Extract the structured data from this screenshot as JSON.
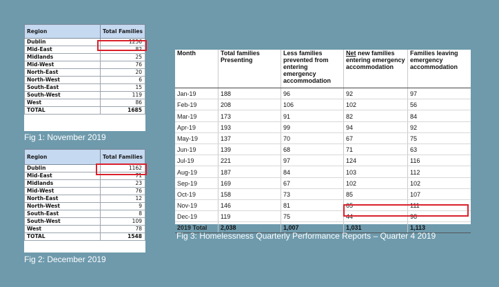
{
  "fig1": {
    "headers": [
      "Region",
      "Total Families"
    ],
    "rows": [
      [
        "Dublin",
        "1256"
      ],
      [
        "Mid-East",
        "82"
      ],
      [
        "Midlands",
        "25"
      ],
      [
        "Mid-West",
        "76"
      ],
      [
        "North-East",
        "20"
      ],
      [
        "North-West",
        "6"
      ],
      [
        "South-East",
        "15"
      ],
      [
        "South-West",
        "119"
      ],
      [
        "West",
        "86"
      ],
      [
        "TOTAL",
        "1685"
      ]
    ],
    "caption": "Fig 1: November 2019"
  },
  "fig2": {
    "headers": [
      "Region",
      "Total Families"
    ],
    "rows": [
      [
        "Dublin",
        "1162"
      ],
      [
        "Mid-East",
        "71"
      ],
      [
        "Midlands",
        "23"
      ],
      [
        "Mid-West",
        "76"
      ],
      [
        "North-East",
        "12"
      ],
      [
        "North-West",
        "9"
      ],
      [
        "South-East",
        "8"
      ],
      [
        "South-West",
        "109"
      ],
      [
        "West",
        "78"
      ],
      [
        "TOTAL",
        "1548"
      ]
    ],
    "caption": "Fig 2: December 2019"
  },
  "fig3": {
    "headers": [
      "Month",
      "Total families Presenting",
      "Less families prevented from entering emergency accommodation",
      "Net new families entering emergency accommodation",
      "Families leaving emergency accommodation"
    ],
    "header_underlined_word": "Net",
    "rows": [
      [
        "Jan-19",
        "188",
        "96",
        "92",
        "97"
      ],
      [
        "Feb-19",
        "208",
        "106",
        "102",
        "56"
      ],
      [
        "Mar-19",
        "173",
        "91",
        "82",
        "84"
      ],
      [
        "Apr-19",
        "193",
        "99",
        "94",
        "92"
      ],
      [
        "May-19",
        "137",
        "70",
        "67",
        "75"
      ],
      [
        "Jun-19",
        "139",
        "68",
        "71",
        "63"
      ],
      [
        "Jul-19",
        "221",
        "97",
        "124",
        "116"
      ],
      [
        "Aug-19",
        "187",
        "84",
        "103",
        "112"
      ],
      [
        "Sep-19",
        "169",
        "67",
        "102",
        "102"
      ],
      [
        "Oct-19",
        "158",
        "73",
        "85",
        "107"
      ],
      [
        "Nov-19",
        "146",
        "81",
        "65",
        "111"
      ],
      [
        "Dec-19",
        "119",
        "75",
        "44",
        "98"
      ],
      [
        "2019 Total",
        "2,038",
        "1,007",
        "1,031",
        "1,113"
      ]
    ],
    "caption": "Fig 3: Homelessness Quarterly Performance Reports – Quarter 4 2019"
  },
  "highlight_color": "#d9202b"
}
